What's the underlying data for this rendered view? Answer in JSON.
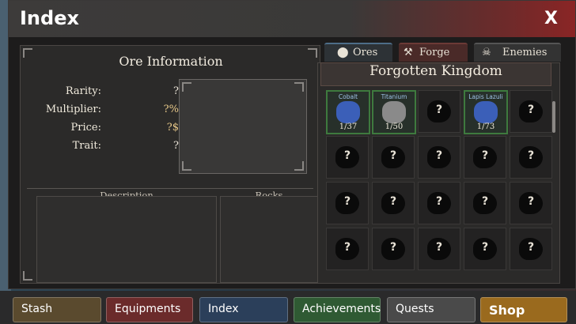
{
  "window": {
    "title": "Index",
    "close_label": "X"
  },
  "ore_info": {
    "heading": "Ore Information",
    "rows": [
      {
        "label": "Rarity:",
        "value": "?"
      },
      {
        "label": "Multiplier:",
        "value": "?%"
      },
      {
        "label": "Price:",
        "value": "?$"
      },
      {
        "label": "Trait:",
        "value": "?"
      }
    ],
    "description_label": "Description",
    "rocks_label": "Rocks"
  },
  "tabs": [
    {
      "label": "Ores",
      "icon": "ore-icon"
    },
    {
      "label": "Forge",
      "icon": "hammer-icon"
    },
    {
      "label": "Enemies",
      "icon": "skull-icon"
    }
  ],
  "region": {
    "name": "Forgotten Kingdom"
  },
  "ores": [
    {
      "name": "Cobalt",
      "count": "1/37",
      "discovered": true
    },
    {
      "name": "Titanium",
      "count": "1/50",
      "discovered": true
    },
    {
      "name": "",
      "count": "",
      "discovered": false
    },
    {
      "name": "Lapis Lazuli",
      "count": "1/73",
      "discovered": true
    },
    {
      "name": "",
      "count": "",
      "discovered": false
    },
    {
      "name": "",
      "count": "",
      "discovered": false
    },
    {
      "name": "",
      "count": "",
      "discovered": false
    },
    {
      "name": "",
      "count": "",
      "discovered": false
    },
    {
      "name": "",
      "count": "",
      "discovered": false
    },
    {
      "name": "",
      "count": "",
      "discovered": false
    },
    {
      "name": "",
      "count": "",
      "discovered": false
    },
    {
      "name": "",
      "count": "",
      "discovered": false
    },
    {
      "name": "",
      "count": "",
      "discovered": false
    },
    {
      "name": "",
      "count": "",
      "discovered": false
    },
    {
      "name": "",
      "count": "",
      "discovered": false
    },
    {
      "name": "",
      "count": "",
      "discovered": false
    },
    {
      "name": "",
      "count": "",
      "discovered": false
    },
    {
      "name": "",
      "count": "",
      "discovered": false
    },
    {
      "name": "",
      "count": "",
      "discovered": false
    },
    {
      "name": "",
      "count": "",
      "discovered": false
    }
  ],
  "unknown_mark": "?",
  "nav": [
    {
      "label": "Stash",
      "color": "#5a4a2e"
    },
    {
      "label": "Equipments",
      "color": "#6b2b2b"
    },
    {
      "label": "Index",
      "color": "#2b3f5a"
    },
    {
      "label": "Achievements",
      "color": "#2f5a33"
    },
    {
      "label": "Quests",
      "color": "#4a4a4a"
    },
    {
      "label": "Shop",
      "color": "#9a6a1e"
    }
  ]
}
